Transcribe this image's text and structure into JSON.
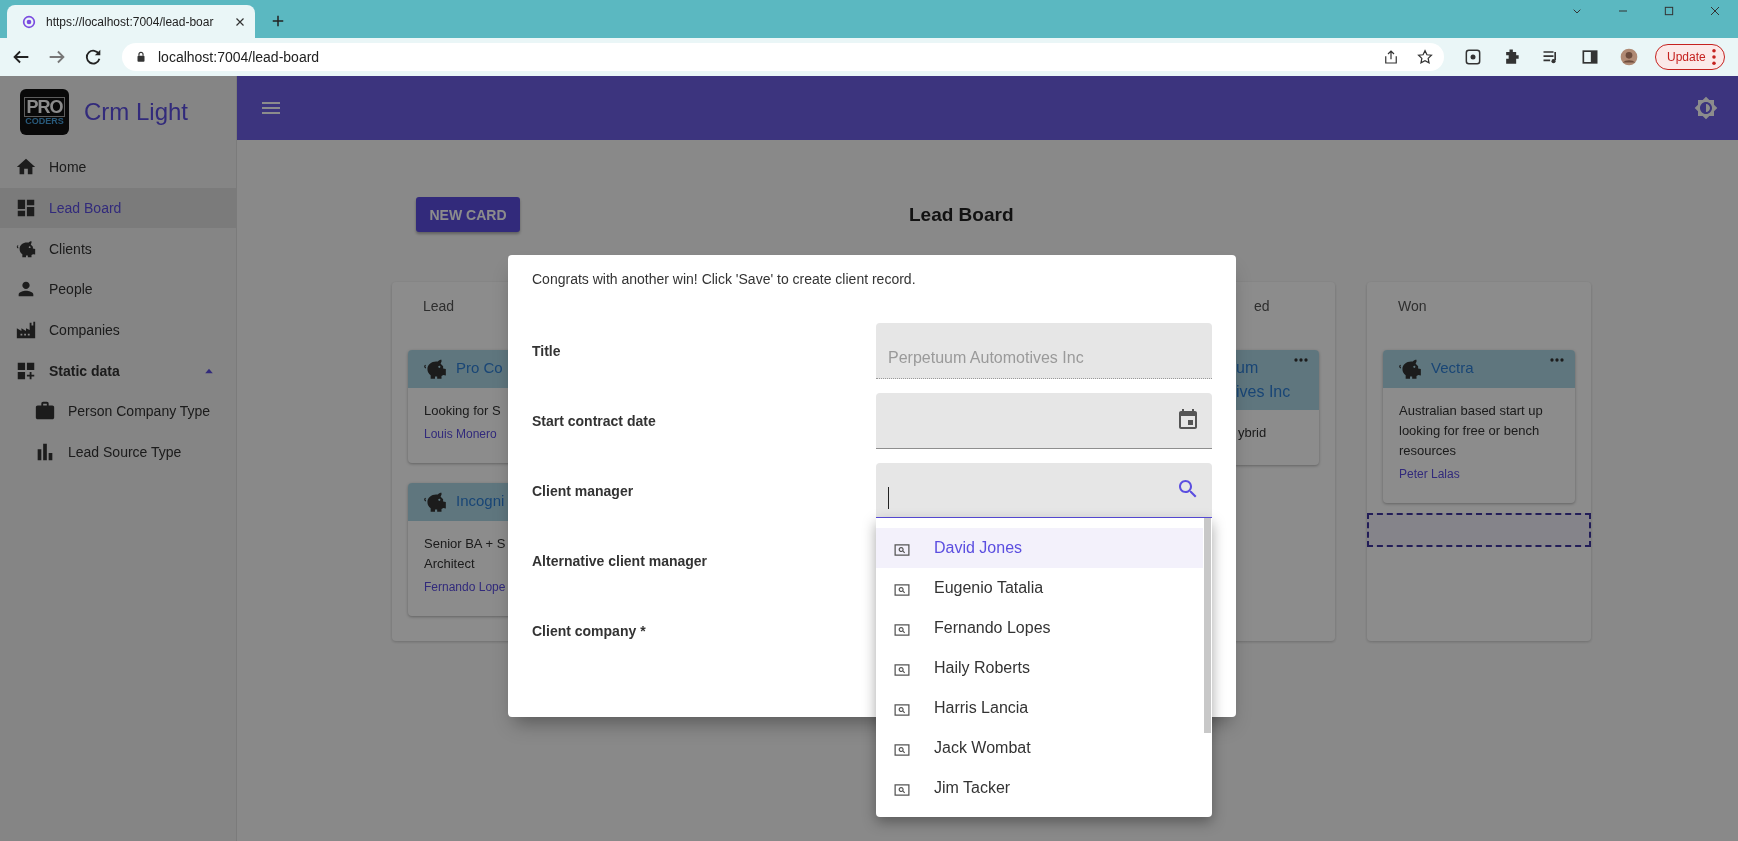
{
  "browser": {
    "tab_title": "https://localhost:7004/lead-boar",
    "url": "localhost:7004/lead-board",
    "update_label": "Update"
  },
  "sidebar": {
    "logo": {
      "line1": "PRO",
      "line2": "CODERS"
    },
    "app_name": "Crm Light",
    "items": [
      {
        "label": "Home",
        "selected": false
      },
      {
        "label": "Lead Board",
        "selected": true
      },
      {
        "label": "Clients",
        "selected": false
      },
      {
        "label": "People",
        "selected": false
      },
      {
        "label": "Companies",
        "selected": false
      },
      {
        "label": "Static data",
        "selected": false,
        "expanded": true,
        "children": [
          {
            "label": "Person Company Type",
            "selected": false
          },
          {
            "label": "Lead Source Type",
            "selected": false
          }
        ]
      }
    ]
  },
  "toolbar": {
    "new_card_label": "NEW CARD",
    "title": "Lead Board"
  },
  "board": {
    "columns": [
      {
        "title": "Lead",
        "cards": [
          {
            "title_lines": [
              "Pro Co"
            ],
            "description_lines": [
              "Looking for S"
            ],
            "person": "Louis Monero"
          },
          {
            "title_lines": [
              "Incogni"
            ],
            "description_lines": [
              "Senior BA + S",
              "Architect"
            ],
            "person": "Fernando Lope"
          }
        ]
      },
      {
        "title": "ed",
        "cards": [
          {
            "title_lines": [
              "um",
              "ives Inc"
            ],
            "description_lines": [
              "ybrid"
            ]
          }
        ]
      },
      {
        "title": "Won",
        "cards": [
          {
            "title_lines": [
              "Vectra"
            ],
            "description_lines": [
              "Australian based start up",
              "looking for free or bench",
              "resources"
            ],
            "person": "Peter Lalas"
          }
        ]
      }
    ]
  },
  "dialog": {
    "message": "Congrats with another win! Click 'Save' to create client record.",
    "fields": [
      {
        "label": "Title",
        "kind": "text",
        "value": "Perpetuum Automotives Inc",
        "disabled": true
      },
      {
        "label": "Start contract date",
        "kind": "date"
      },
      {
        "label": "Client manager",
        "kind": "search",
        "focused": true
      },
      {
        "label": "Alternative client manager"
      },
      {
        "label": "Client company *"
      }
    ],
    "dropdown": {
      "options": [
        {
          "label": "David Jones",
          "selected": true
        },
        {
          "label": "Eugenio Tatalia",
          "selected": false
        },
        {
          "label": "Fernando Lopes",
          "selected": false
        },
        {
          "label": "Haily Roberts",
          "selected": false
        },
        {
          "label": "Harris Lancia",
          "selected": false
        },
        {
          "label": "Jack Wombat",
          "selected": false
        },
        {
          "label": "Jim Tacker",
          "selected": false
        }
      ]
    }
  }
}
